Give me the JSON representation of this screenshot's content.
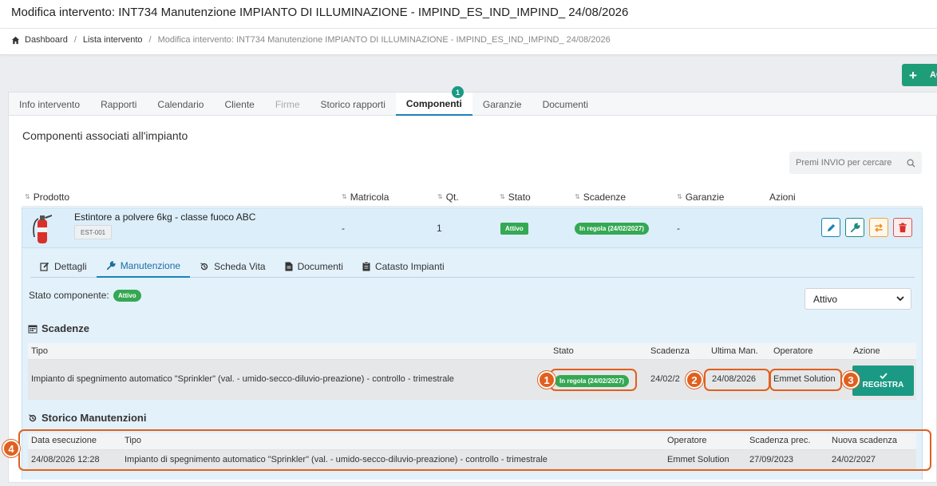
{
  "header": {
    "title": "Modifica intervento: INT734 Manutenzione IMPIANTO DI ILLUMINAZIONE - IMPIND_ES_IND_IMPIND_ 24/08/2026"
  },
  "breadcrumb": {
    "home": "Dashboard",
    "list": "Lista intervento",
    "current": "Modifica intervento: INT734 Manutenzione IMPIANTO DI ILLUMINAZIONE - IMPIND_ES_IND_IMPIND_ 24/08/2026"
  },
  "add_button": {
    "label": "AC"
  },
  "tabs": [
    {
      "label": "Info intervento",
      "state": "normal"
    },
    {
      "label": "Rapporti",
      "state": "normal"
    },
    {
      "label": "Calendario",
      "state": "normal"
    },
    {
      "label": "Cliente",
      "state": "normal"
    },
    {
      "label": "Firme",
      "state": "disabled"
    },
    {
      "label": "Storico rapporti",
      "state": "normal"
    },
    {
      "label": "Componenti",
      "state": "active"
    },
    {
      "label": "Garanzie",
      "state": "normal"
    },
    {
      "label": "Documenti",
      "state": "normal"
    }
  ],
  "tab_badge": "1",
  "section_title": "Componenti associati all'impianto",
  "search": {
    "placeholder": "Premi INVIO per cercare"
  },
  "components_table": {
    "headers": [
      "Prodotto",
      "Matricola",
      "Qt.",
      "Stato",
      "Scadenze",
      "Garanzie",
      "Azioni"
    ],
    "row": {
      "name": "Estintore a polvere 6kg - classe fuoco ABC",
      "code": "EST-001",
      "matricola": "-",
      "qty": "1",
      "stato": "Attivo",
      "scadenze": "In regola (24/02/2027)",
      "garanzie": "-"
    }
  },
  "subtabs": [
    {
      "label": "Dettagli",
      "icon": "edit-icon"
    },
    {
      "label": "Manutenzione",
      "icon": "wrench-icon",
      "active": true
    },
    {
      "label": "Scheda Vita",
      "icon": "history-icon"
    },
    {
      "label": "Documenti",
      "icon": "file-icon"
    },
    {
      "label": "Catasto Impianti",
      "icon": "clipboard-icon"
    }
  ],
  "stato_componente": {
    "label": "Stato componente:",
    "value": "Attivo"
  },
  "status_select": {
    "value": "Attivo"
  },
  "scadenze": {
    "title": "Scadenze",
    "headers": [
      "Tipo",
      "Stato",
      "Scadenza",
      "Ultima Man.",
      "Operatore",
      "Azione"
    ],
    "row": {
      "tipo": "Impianto di spegnimento automatico \"Sprinkler\" (val. - umido-secco-diluvio-preazione) - controllo - trimestrale",
      "stato": "In regola (24/02/2027)",
      "scadenza": "24/02/2",
      "ultima": "24/08/2026",
      "operatore": "Emmet Solution",
      "azione": "REGISTRA"
    }
  },
  "storico": {
    "title": "Storico Manutenzioni",
    "headers": [
      "Data esecuzione",
      "Tipo",
      "Operatore",
      "Scadenza prec.",
      "Nuova scadenza"
    ],
    "row": {
      "data": "24/08/2026 12:28",
      "tipo": "Impianto di spegnimento automatico \"Sprinkler\" (val. - umido-secco-diluvio-preazione) - controllo - trimestrale",
      "operatore": "Emmet Solution",
      "scadenza_prec": "27/09/2023",
      "nuova_scadenza": "24/02/2027"
    }
  },
  "annotations": [
    "1",
    "2",
    "3",
    "4"
  ],
  "colors": {
    "accent": "#1a83b8",
    "success": "#34a853",
    "teal": "#1a9a84",
    "annotation": "#e0601f"
  }
}
